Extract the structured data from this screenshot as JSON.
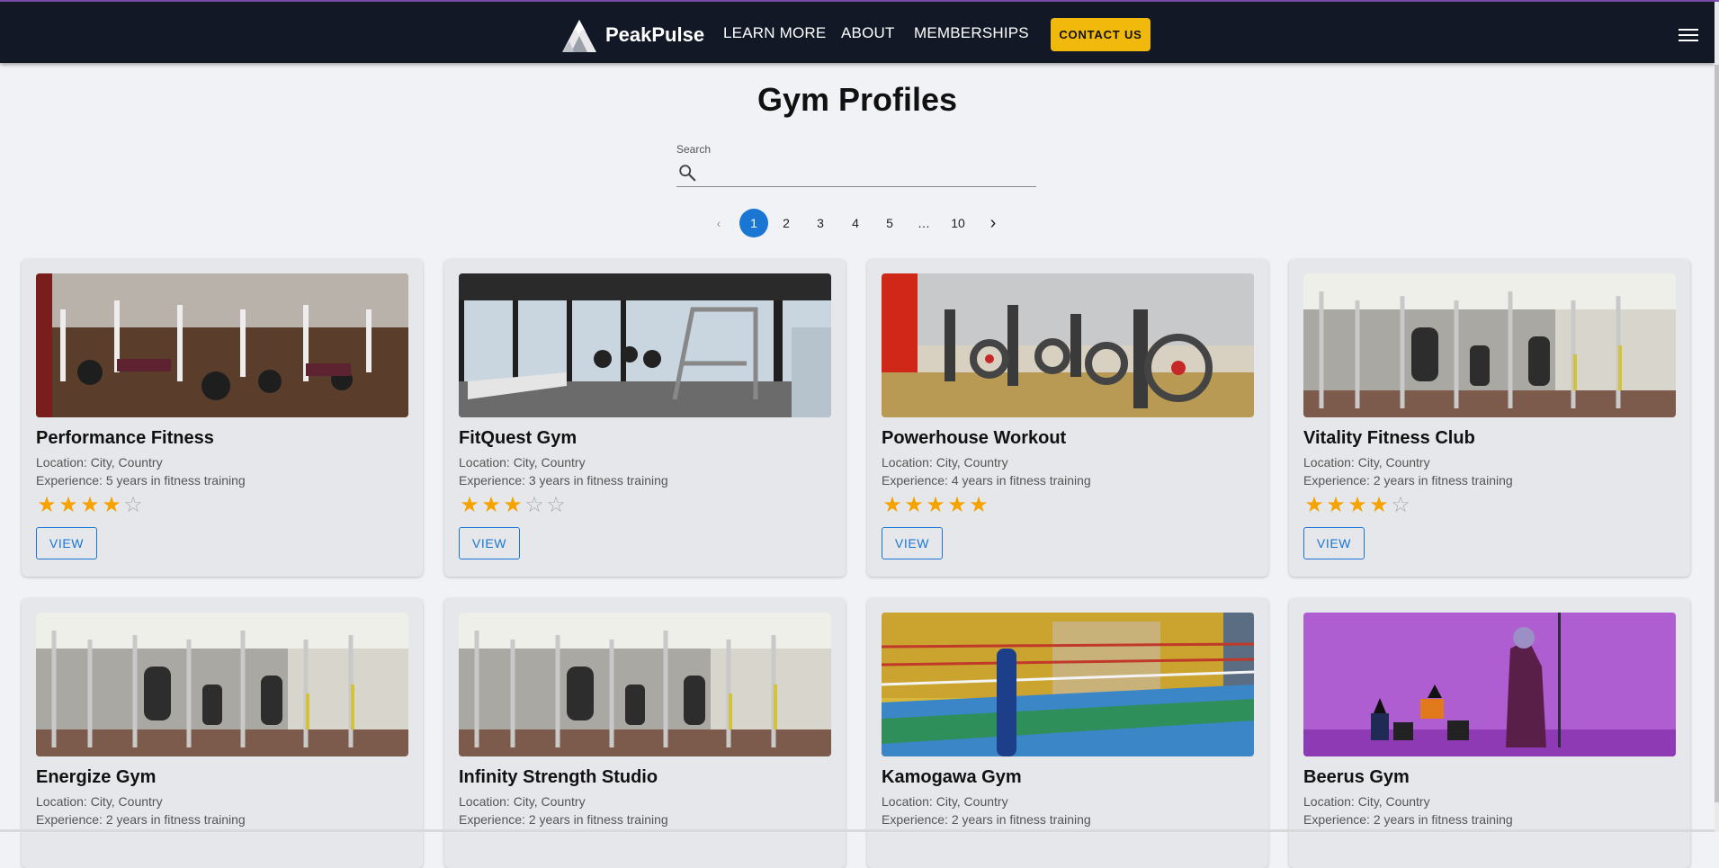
{
  "app": {
    "brand": "PeakPulse"
  },
  "nav": {
    "links": [
      "LEARN MORE",
      "ABOUT",
      "MEMBERSHIPS"
    ],
    "cta_label": "CONTACT US",
    "menu_icon": "hamburger-menu-icon"
  },
  "page": {
    "title": "Gym Profiles"
  },
  "search": {
    "label": "Search",
    "value": "",
    "placeholder": "",
    "icon": "search-icon"
  },
  "pagination": {
    "current": 1,
    "pages": [
      "1",
      "2",
      "3",
      "4",
      "5",
      "…",
      "10"
    ],
    "prev_icon": "chevron-left-icon",
    "next_icon": "chevron-right-icon"
  },
  "card_button_label": "VIEW",
  "colors": {
    "nav_bg": "#121826",
    "accent": "#1976d2",
    "cta": "#f0b90b",
    "star": "#f5a300"
  },
  "gyms": [
    {
      "name": "Performance Fitness",
      "location": "Location: City, Country",
      "experience": "Experience: 5 years in fitness training",
      "rating": 4,
      "max_rating": 5,
      "photo": "free-weights-gym-photo"
    },
    {
      "name": "FitQuest Gym",
      "location": "Location: City, Country",
      "experience": "Experience: 3 years in fitness training",
      "rating": 3,
      "max_rating": 5,
      "photo": "treadmill-city-view-photo"
    },
    {
      "name": "Powerhouse Workout",
      "location": "Location: City, Country",
      "experience": "Experience: 4 years in fitness training",
      "rating": 5,
      "max_rating": 5,
      "photo": "spin-bikes-photo"
    },
    {
      "name": "Vitality Fitness Club",
      "location": "Location: City, Country",
      "experience": "Experience: 2 years in fitness training",
      "rating": 4,
      "max_rating": 5,
      "photo": "machines-gym-photo"
    },
    {
      "name": "Energize Gym",
      "location": "Location: City, Country",
      "experience": "Experience: 2 years in fitness training",
      "rating": 0,
      "max_rating": 5,
      "photo": "machines-gym-photo"
    },
    {
      "name": "Infinity Strength Studio",
      "location": "Location: City, Country",
      "experience": "Experience: 2 years in fitness training",
      "rating": 0,
      "max_rating": 5,
      "photo": "machines-gym-photo"
    },
    {
      "name": "Kamogawa Gym",
      "location": "Location: City, Country",
      "experience": "Experience: 2 years in fitness training",
      "rating": 0,
      "max_rating": 5,
      "photo": "boxing-ring-anime-photo"
    },
    {
      "name": "Beerus Gym",
      "location": "Location: City, Country",
      "experience": "Experience: 2 years in fitness training",
      "rating": 0,
      "max_rating": 5,
      "photo": "purple-anime-scene-photo"
    }
  ]
}
